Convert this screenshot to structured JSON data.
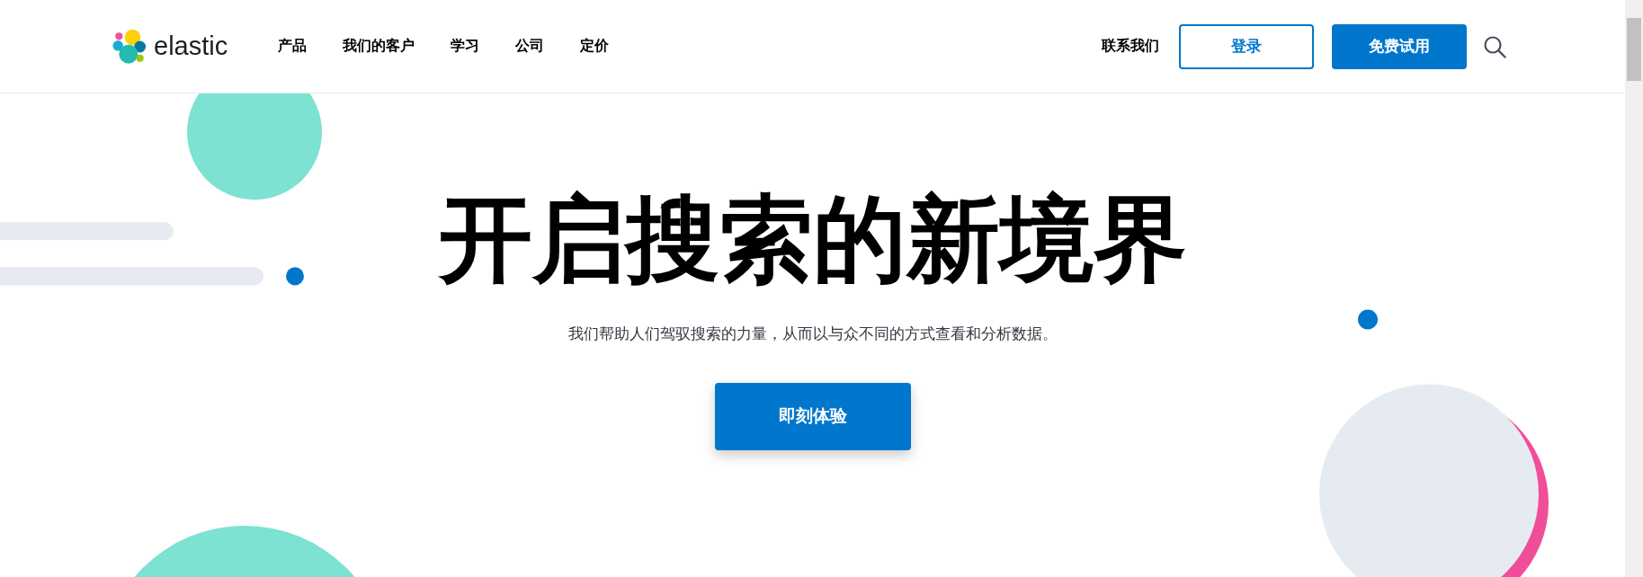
{
  "header": {
    "logo_text": "elastic",
    "nav": [
      {
        "label": "产品"
      },
      {
        "label": "我们的客户"
      },
      {
        "label": "学习"
      },
      {
        "label": "公司"
      },
      {
        "label": "定价"
      }
    ],
    "contact": "联系我们",
    "login": "登录",
    "trial": "免费试用"
  },
  "hero": {
    "title": "开启搜索的新境界",
    "subtitle": "我们帮助人们驾驭搜索的力量，从而以与众不同的方式查看和分析数据。",
    "cta": "即刻体验"
  }
}
